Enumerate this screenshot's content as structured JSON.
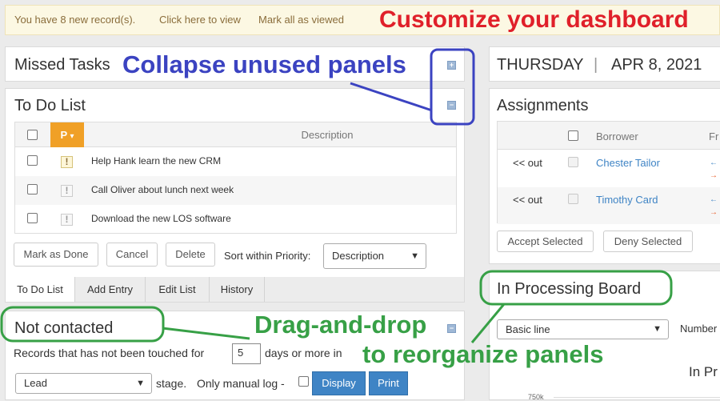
{
  "notification": {
    "text": "You have 8 new record(s).",
    "view_link": "Click here to view",
    "mark_link": "Mark all as viewed"
  },
  "missed_tasks": {
    "title": "Missed Tasks",
    "expand_symbol": "+"
  },
  "todo": {
    "title": "To Do List",
    "collapse_symbol": "−",
    "priority_header": "P",
    "priority_caret": "▾",
    "description_header": "Description",
    "rows": [
      {
        "priority_symbol": "!",
        "description": "Help Hank learn the new CRM"
      },
      {
        "priority_symbol": "!",
        "description": "Call Oliver about lunch next week"
      },
      {
        "priority_symbol": "!",
        "description": "Download the new LOS software"
      }
    ],
    "buttons": {
      "mark_done": "Mark as Done",
      "cancel": "Cancel",
      "delete": "Delete"
    },
    "sort_label": "Sort within Priority:",
    "sort_value": "Description",
    "tabs": [
      "To Do List",
      "Add Entry",
      "Edit List",
      "History"
    ]
  },
  "not_contacted": {
    "title": "Not contacted",
    "collapse_symbol": "−",
    "text_before": "Records that has not been touched for",
    "days_value": "5",
    "text_after": "days or more in",
    "type_value": "Lead",
    "stage_text": "stage.",
    "manual_log_text": "Only manual log -",
    "display_button": "Display",
    "print_button": "Print"
  },
  "date_panel": {
    "day": "THURSDAY",
    "separator": "|",
    "date": "APR 8, 2021"
  },
  "assignments": {
    "title": "Assignments",
    "headers": {
      "borrower": "Borrower",
      "from": "Fr"
    },
    "rows": [
      {
        "direction": "<< out",
        "borrower": "Chester Tailor"
      },
      {
        "direction": "<< out",
        "borrower": "Timothy Card"
      }
    ],
    "accept_button": "Accept Selected",
    "deny_button": "Deny Selected"
  },
  "processing_board": {
    "title": "In Processing Board",
    "chart_type_value": "Basic line",
    "number_label": "Number",
    "chart_title_partial": "In Pr",
    "axis_tick": "750k"
  },
  "annotations": {
    "customize": "Customize your dashboard",
    "collapse": "Collapse unused panels",
    "drag_line1": "Drag-and-drop",
    "drag_line2": "to reorganize panels"
  },
  "colors": {
    "annotation_red": "#e0202a",
    "annotation_blue": "#3b43c1",
    "annotation_green": "#37a046",
    "primary_blue": "#3f84c5",
    "priority_orange": "#f0a027"
  },
  "icons": {
    "arrow_left": "←",
    "arrow_right": "→"
  }
}
